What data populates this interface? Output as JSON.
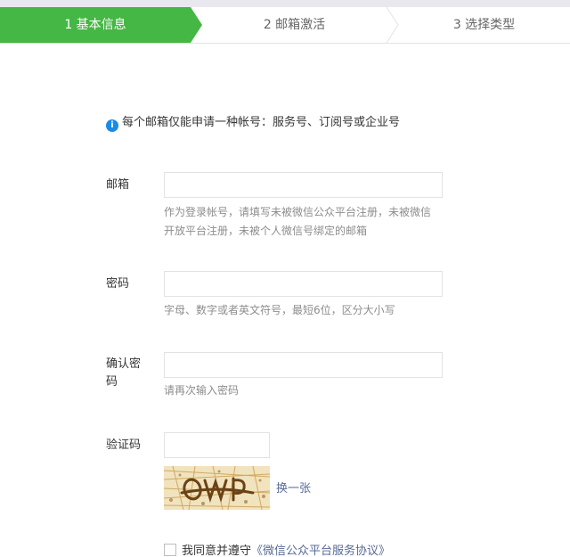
{
  "steps": [
    {
      "label": "1 基本信息",
      "active": true
    },
    {
      "label": "2 邮箱激活",
      "active": false
    },
    {
      "label": "3 选择类型",
      "active": false
    }
  ],
  "notice": {
    "icon": "info-icon",
    "text": "每个邮箱仅能申请一种帐号：服务号、订阅号或企业号"
  },
  "form": {
    "email": {
      "label": "邮箱",
      "value": "",
      "hint": "作为登录帐号，请填写未被微信公众平台注册，未被微信开放平台注册，未被个人微信号绑定的邮箱"
    },
    "password": {
      "label": "密码",
      "value": "",
      "hint": "字母、数字或者英文符号，最短6位，区分大小写"
    },
    "confirm_password": {
      "label": "确认密码",
      "value": "",
      "hint": "请再次输入密码"
    },
    "captcha": {
      "label": "验证码",
      "value": "",
      "refresh_link": "换一张"
    }
  },
  "agreement": {
    "checked": false,
    "prefix": "我同意并遵守",
    "link": "《微信公众平台服务协议》"
  },
  "colors": {
    "active_step": "#45b744",
    "link": "#576b95",
    "info": "#1a8be8"
  }
}
